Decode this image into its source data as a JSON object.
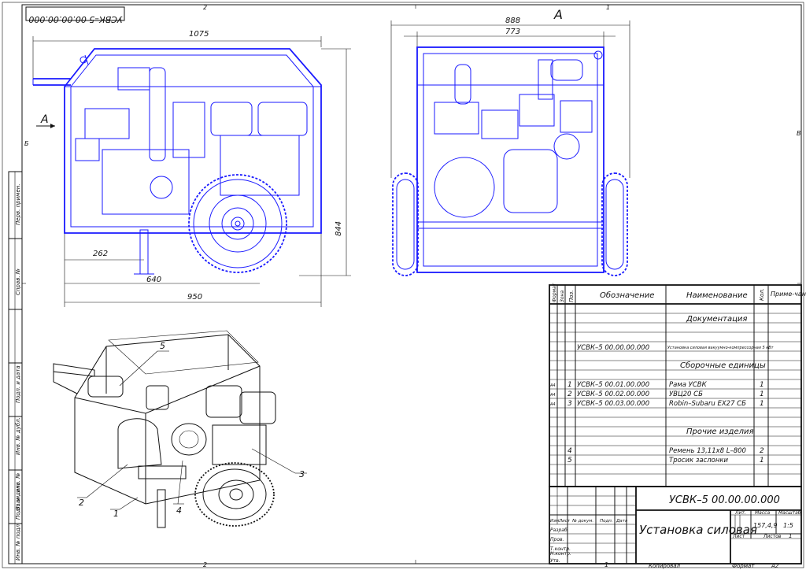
{
  "sheet": {
    "format_label": "Формат",
    "format_value": "А2",
    "copied_label": "Копировал",
    "zones_top": [
      "2",
      "1"
    ],
    "zones_side": [
      "Б",
      "В"
    ],
    "zones_bottom": [
      "2",
      "1"
    ]
  },
  "stamp_rotated": "УСВК–5 00.00.00.000",
  "side_column": [
    {
      "label": "Перв. примен."
    },
    {
      "label": "Справ. №"
    },
    {
      "label": "Подп. и дата"
    },
    {
      "label": "Инв. № дубл."
    },
    {
      "label": "Взам. инв. №"
    },
    {
      "label": "Подп. и дата"
    },
    {
      "label": "Инв. № подл."
    }
  ],
  "front_view": {
    "dims": {
      "overall_width": "1075",
      "height": "844",
      "dim_262": "262",
      "dim_640": "640",
      "dim_950": "950"
    },
    "section_label": "А"
  },
  "side_view": {
    "view_label": "А",
    "dims": {
      "outer": "888",
      "inner": "773"
    }
  },
  "iso_view": {
    "callouts": [
      "1",
      "2",
      "3",
      "4",
      "5"
    ]
  },
  "spec": {
    "headers": {
      "format": "Формат",
      "zone": "Зона",
      "pos": "Поз.",
      "designation": "Обозначение",
      "name": "Наименование",
      "qty": "Кол.",
      "note": "Приме-чание"
    },
    "sections": {
      "documentation": "Документация",
      "assemblies": "Сборочные единицы",
      "other": "Прочие изделия"
    },
    "doc_row": {
      "designation": "УСВК–5 00.00.00.000",
      "name": "Установка силовая вакуумно-компрессорная 5 кВт"
    },
    "assembly_rows": [
      {
        "format": "А4",
        "pos": "1",
        "designation": "УСВК–5 00.01.00.000",
        "name": "Рама УСВК",
        "qty": "1"
      },
      {
        "format": "А4",
        "pos": "2",
        "designation": "УСВК–5 00.02.00.000",
        "name": "УВЦ20 СБ",
        "qty": "1"
      },
      {
        "format": "А4",
        "pos": "3",
        "designation": "УСВК–5 00.03.00.000",
        "name": "Robin–Subaru EX27 СБ",
        "qty": "1"
      }
    ],
    "other_rows": [
      {
        "pos": "4",
        "name": "Ремень 13,11х8 L–800",
        "qty": "2"
      },
      {
        "pos": "5",
        "name": "Тросик заслонки",
        "qty": "1"
      }
    ]
  },
  "title_block": {
    "code": "УСВК–5 00.00.00.000",
    "title": "Установка силовая",
    "left_rows": [
      {
        "label": "Изм."
      },
      {
        "label": "Лист"
      },
      {
        "label": "№ докум."
      },
      {
        "label": "Подп."
      },
      {
        "label": "Дата"
      }
    ],
    "roles": [
      "Разраб.",
      "Пров.",
      "Т.контр.",
      "",
      "Н.контр.",
      "Утв."
    ],
    "lit_label": "Лит.",
    "mass_label": "Масса",
    "scale_label": "Масштаб",
    "mass_value": "157,4,9",
    "scale_value": "1:5",
    "sheet_label": "Лист",
    "sheets_label": "Листов",
    "sheets_value": "1"
  }
}
